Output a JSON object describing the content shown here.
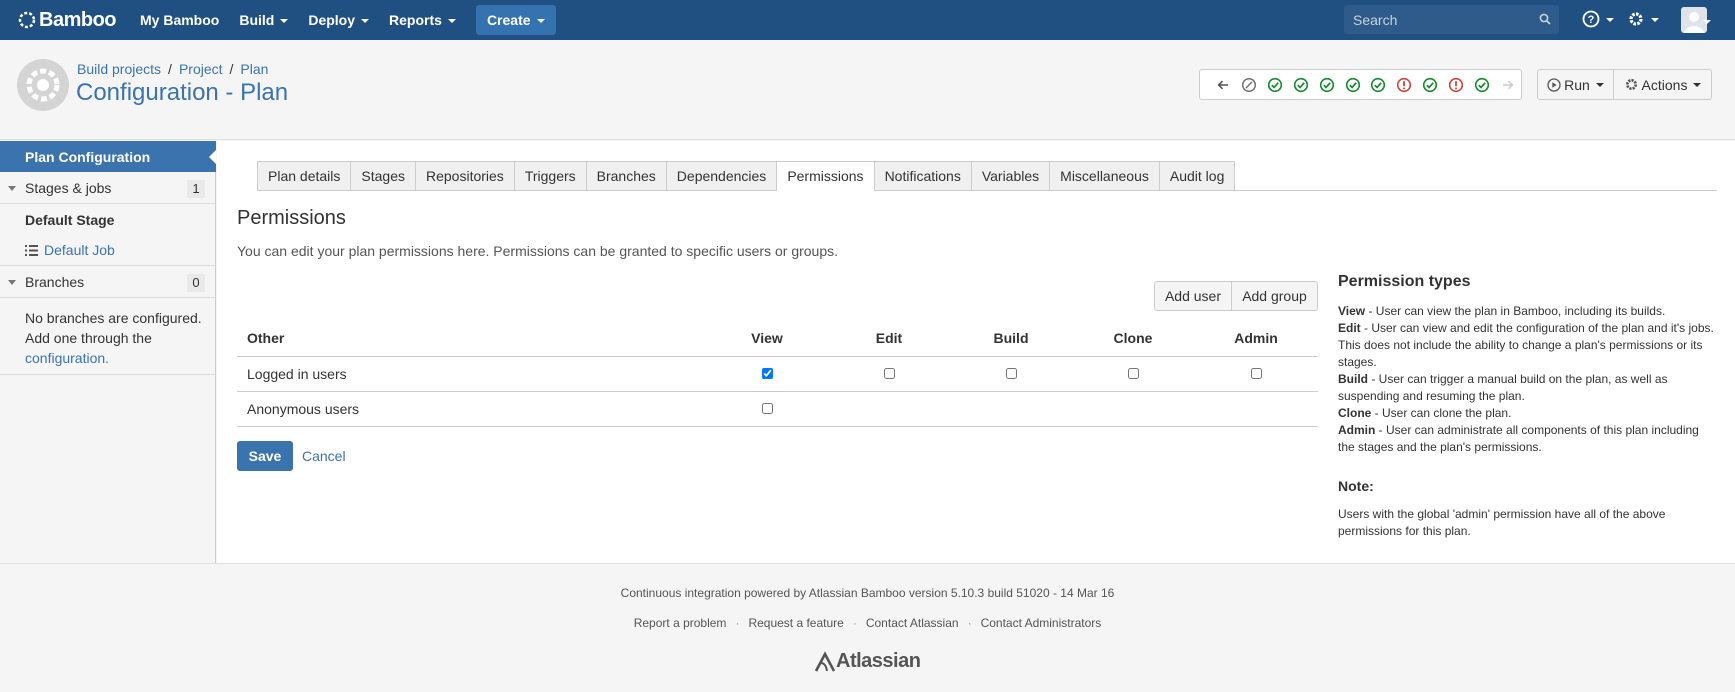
{
  "header": {
    "brand": "Bamboo",
    "nav": [
      "My Bamboo",
      "Build",
      "Deploy",
      "Reports"
    ],
    "create_label": "Create",
    "search_placeholder": "Search"
  },
  "page": {
    "breadcrumb": [
      "Build projects",
      "Project",
      "Plan"
    ],
    "title": "Configuration - Plan",
    "build_statuses": [
      "back",
      "disabled",
      "success",
      "success",
      "success",
      "success",
      "success",
      "failed",
      "success",
      "failed",
      "success",
      "forward"
    ],
    "run_label": "Run",
    "actions_label": "Actions"
  },
  "sidebar": {
    "active": "Plan Configuration",
    "stages_label": "Stages & jobs",
    "stages_count": "1",
    "stage_name": "Default Stage",
    "job_name": "Default Job",
    "branches_label": "Branches",
    "branches_count": "0",
    "branches_note": "No branches are configured. Add one through the",
    "branches_link": "configuration."
  },
  "tabs": [
    "Plan details",
    "Stages",
    "Repositories",
    "Triggers",
    "Branches",
    "Dependencies",
    "Permissions",
    "Notifications",
    "Variables",
    "Miscellaneous",
    "Audit log"
  ],
  "active_tab": "Permissions",
  "permissions": {
    "title": "Permissions",
    "intro": "You can edit your plan permissions here. Permissions can be granted to specific users or groups.",
    "add_user": "Add user",
    "add_group": "Add group",
    "columns": [
      "Other",
      "View",
      "Edit",
      "Build",
      "Clone",
      "Admin"
    ],
    "rows": [
      {
        "name": "Logged in users",
        "view": true,
        "edit": false,
        "build": false,
        "clone": false,
        "admin": false
      },
      {
        "name": "Anonymous users",
        "view": false
      }
    ],
    "save": "Save",
    "cancel": "Cancel"
  },
  "info": {
    "title": "Permission types",
    "items": [
      {
        "term": "View",
        "desc": " - User can view the plan in Bamboo, including its builds."
      },
      {
        "term": "Edit",
        "desc": " - User can view and edit the configuration of the plan and it's jobs. This does not include the ability to change a plan's permissions or its stages."
      },
      {
        "term": "Build",
        "desc": " - User can trigger a manual build on the plan, as well as suspending and resuming the plan."
      },
      {
        "term": "Clone",
        "desc": " - User can clone the plan."
      },
      {
        "term": "Admin",
        "desc": " - User can administrate all components of this plan including the stages and the plan's permissions."
      }
    ],
    "note_title": "Note:",
    "note": "Users with the global 'admin' permission have all of the above permissions for this plan."
  },
  "footer": {
    "powered": "Continuous integration powered by Atlassian Bamboo version 5.10.3 build 51020 - 14 Mar 16",
    "links": [
      "Report a problem",
      "Request a feature",
      "Contact Atlassian",
      "Contact Administrators"
    ],
    "logo": "Atlassian"
  },
  "colors": {
    "header": "#205081",
    "link": "#3b73af",
    "success": "#14892c",
    "failed": "#d04437"
  }
}
